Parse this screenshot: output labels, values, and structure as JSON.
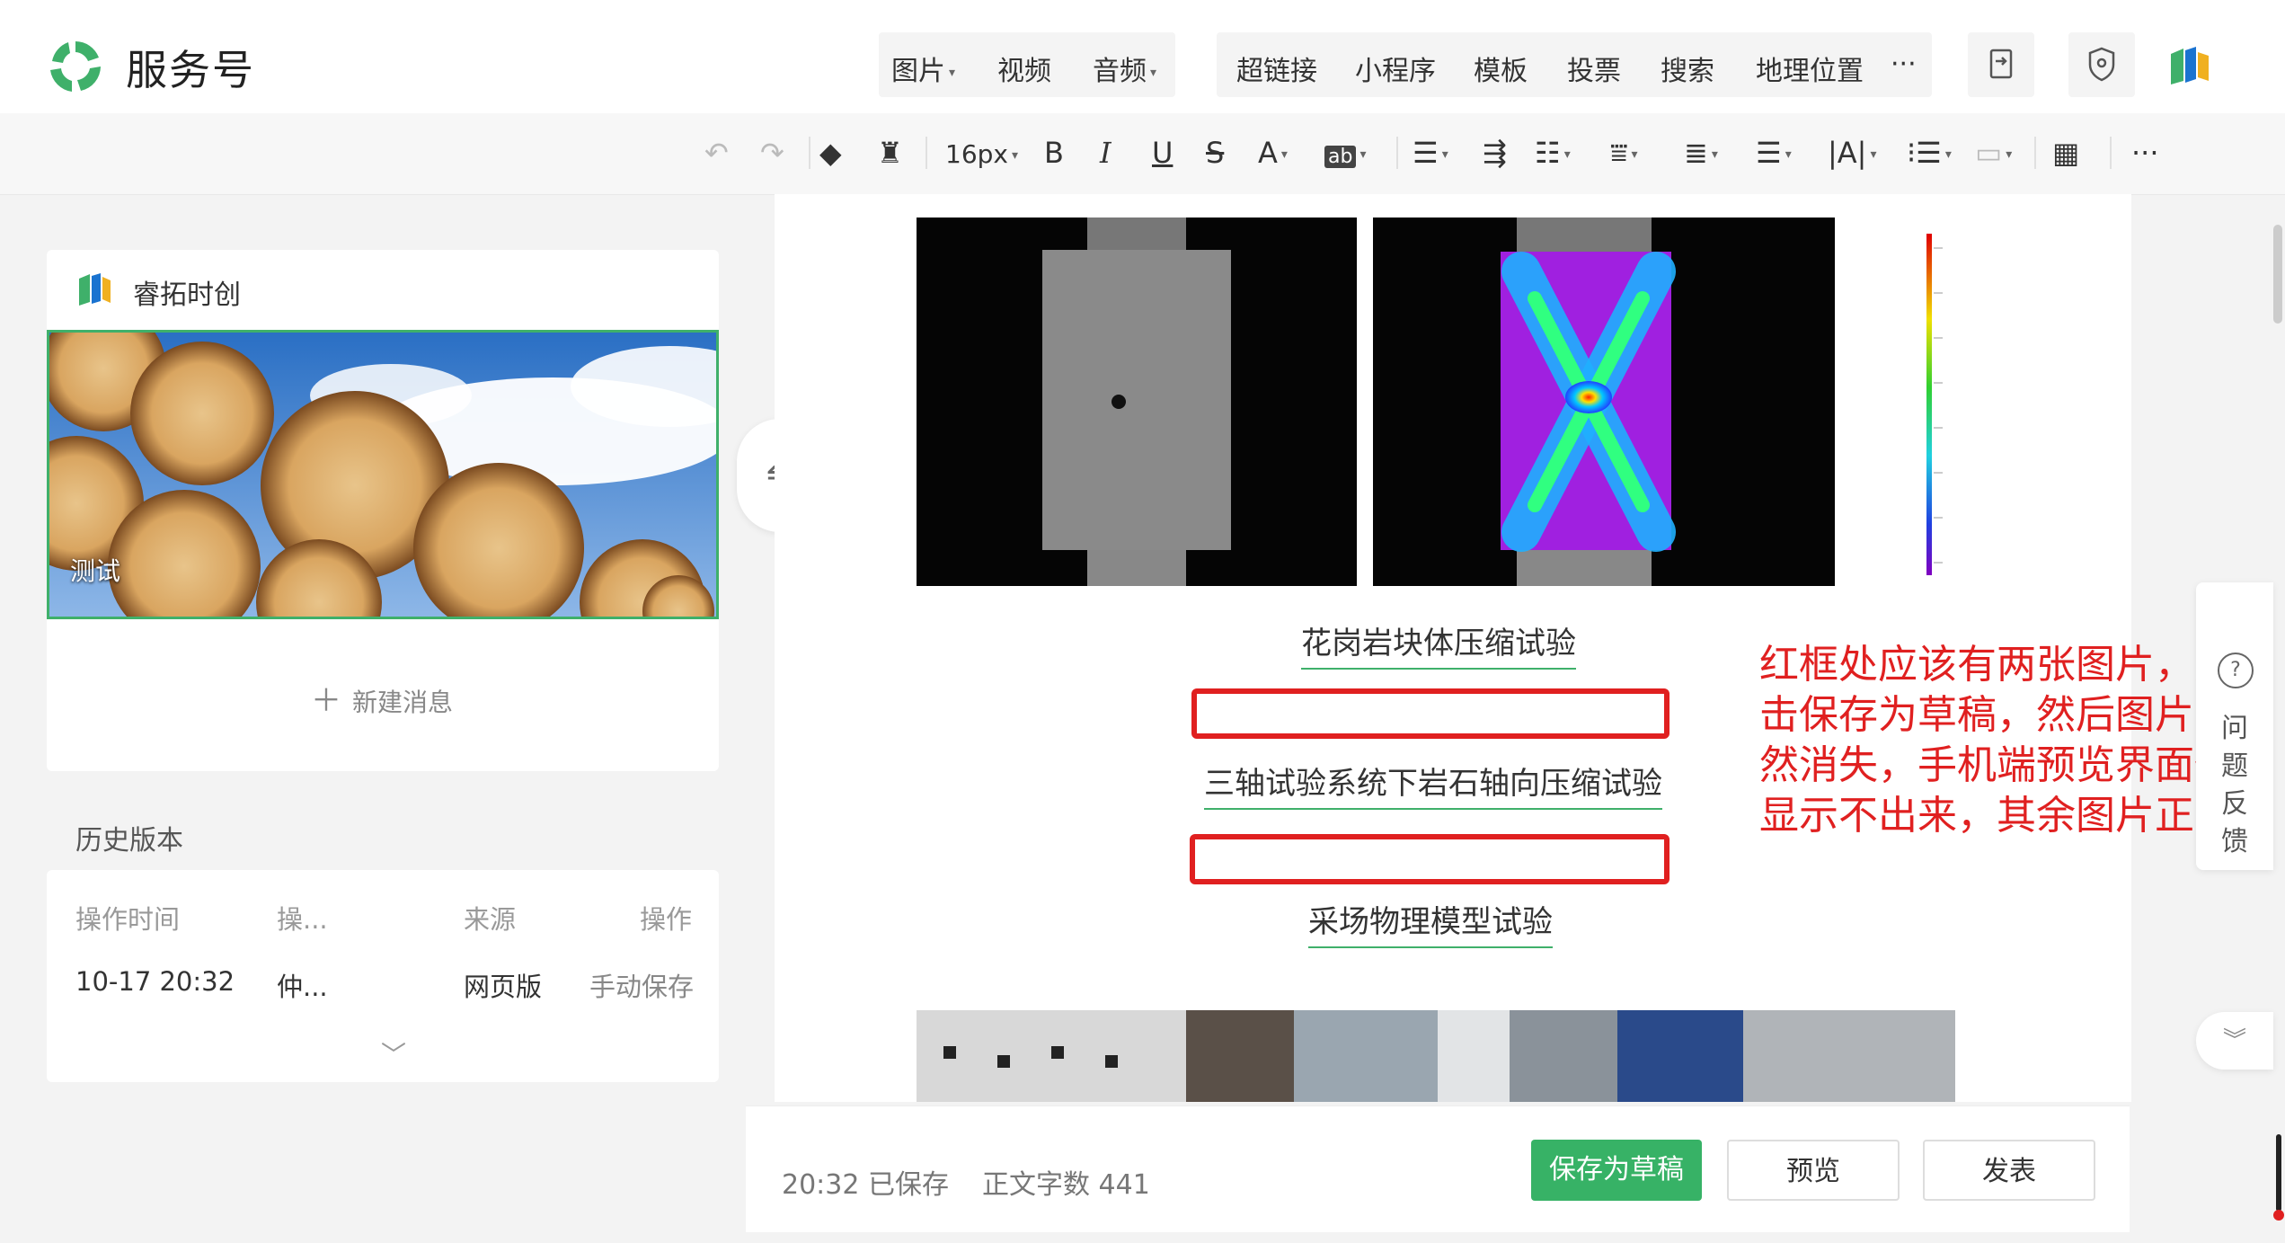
{
  "header": {
    "app_title": "服务号",
    "menu_group_1": [
      {
        "label": "图片",
        "dropdown": true
      },
      {
        "label": "视频",
        "dropdown": false
      },
      {
        "label": "音频",
        "dropdown": true
      }
    ],
    "menu_group_2": [
      {
        "label": "超链接"
      },
      {
        "label": "小程序"
      },
      {
        "label": "模板"
      },
      {
        "label": "投票"
      },
      {
        "label": "搜索"
      },
      {
        "label": "地理位置"
      },
      {
        "label": "···"
      }
    ]
  },
  "toolbar": {
    "font_size": "16px",
    "bold": "B",
    "italic": "I",
    "underline": "U",
    "strike": "S",
    "font_color": "A",
    "bg_color": "ab",
    "more": "···"
  },
  "left_panel": {
    "account_name": "睿拓时创",
    "cover_caption": "测试",
    "new_message": "新建消息",
    "history_title": "历史版本",
    "history_headers": [
      "操作时间",
      "操...",
      "来源",
      "操作"
    ],
    "history_rows": [
      [
        "10-17 20:32",
        "仲...",
        "网页版",
        "手动保存"
      ]
    ]
  },
  "editor": {
    "captions": [
      "花岗岩块体压缩试验",
      "三轴试验系统下岩石轴向压缩试验",
      "采场物理模型试验"
    ]
  },
  "annotation": "红框处应该有两张图片，点击保存为草稿，然后图片突然消失，手机端预览界面也显示不出来，其余图片正常",
  "bottom_bar": {
    "save_time": "20:32",
    "save_status": "已保存",
    "word_count_label": "正文字数",
    "word_count": "441",
    "save_draft": "保存为草稿",
    "preview": "预览",
    "publish": "发表"
  },
  "feedback_label": "问题反馈",
  "colors": {
    "accent_green": "#37b266",
    "annotation_red": "#e02020"
  }
}
